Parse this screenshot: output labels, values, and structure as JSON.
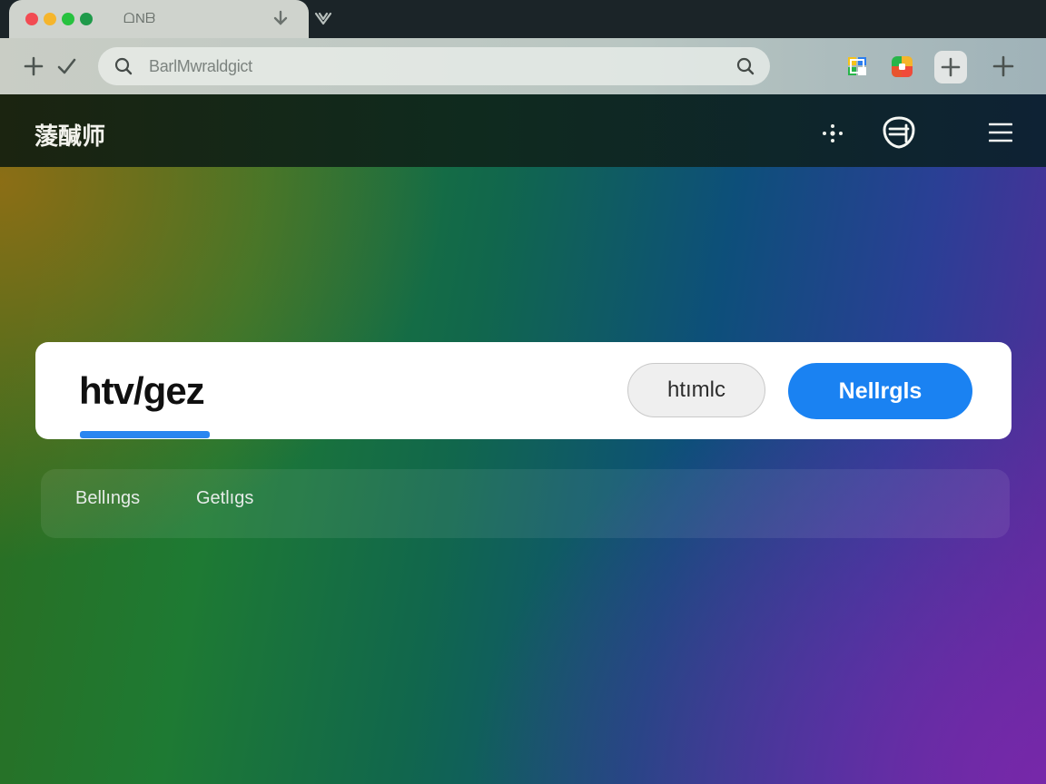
{
  "browser": {
    "tab_title": "ᗝNᗷ",
    "address_text": "BarlMwraldgict",
    "window_controls": [
      "close-dot",
      "minimize-dot",
      "zoom-dot",
      "extra-dot"
    ],
    "icons": {
      "back": "plus-icon",
      "check": "checkmark-icon",
      "search": "search-icon",
      "tab_down": "arrow-down-icon",
      "tab_chevron": "chevron-down-icon",
      "ext_1": "grid-extension-icon",
      "ext_2": "colorful-extension-icon",
      "ext_3": "plus-square-icon",
      "new_tab": "plus-icon"
    },
    "colors": {
      "close": "#f24b52",
      "minimize": "#f5b52c",
      "zoom": "#27c23f",
      "extra": "#1f9a4a"
    }
  },
  "header": {
    "title": "蔆醎师",
    "icons": [
      "move-icon",
      "shield-icon",
      "menu-icon"
    ]
  },
  "card": {
    "title": "htv/gez",
    "secondary_button": "htımlc",
    "primary_button": "Nellrgls",
    "accent_color": "#1a82f2"
  },
  "subbar": {
    "tabs": [
      "Bellıngs",
      "Getlıgs"
    ]
  }
}
